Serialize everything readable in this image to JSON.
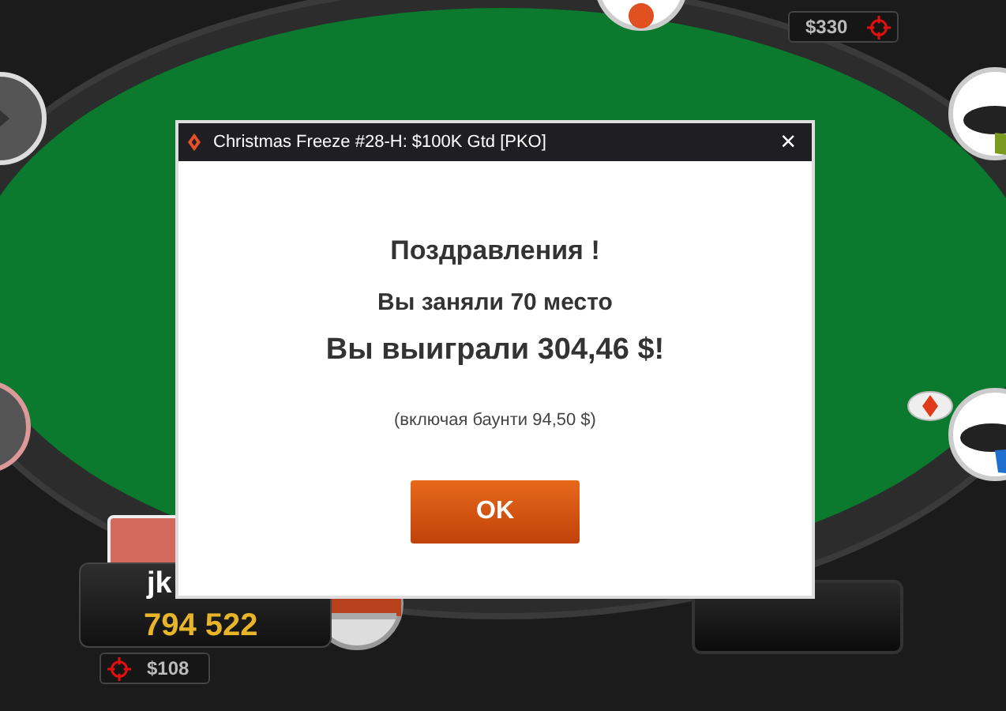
{
  "table": {
    "top_seat": {
      "stack": "$330"
    },
    "hero": {
      "name": "jk",
      "chips": "794 522",
      "bounty": "$108"
    }
  },
  "dialog": {
    "title": "Christmas Freeze #28-H: $100K Gtd [PKO]",
    "close": "×",
    "heading": "Поздравления !",
    "place": "Вы заняли 70 место",
    "prize": "Вы выиграли 304,46 $!",
    "note": "(включая баунти 94,50 $)",
    "button": "OK"
  }
}
